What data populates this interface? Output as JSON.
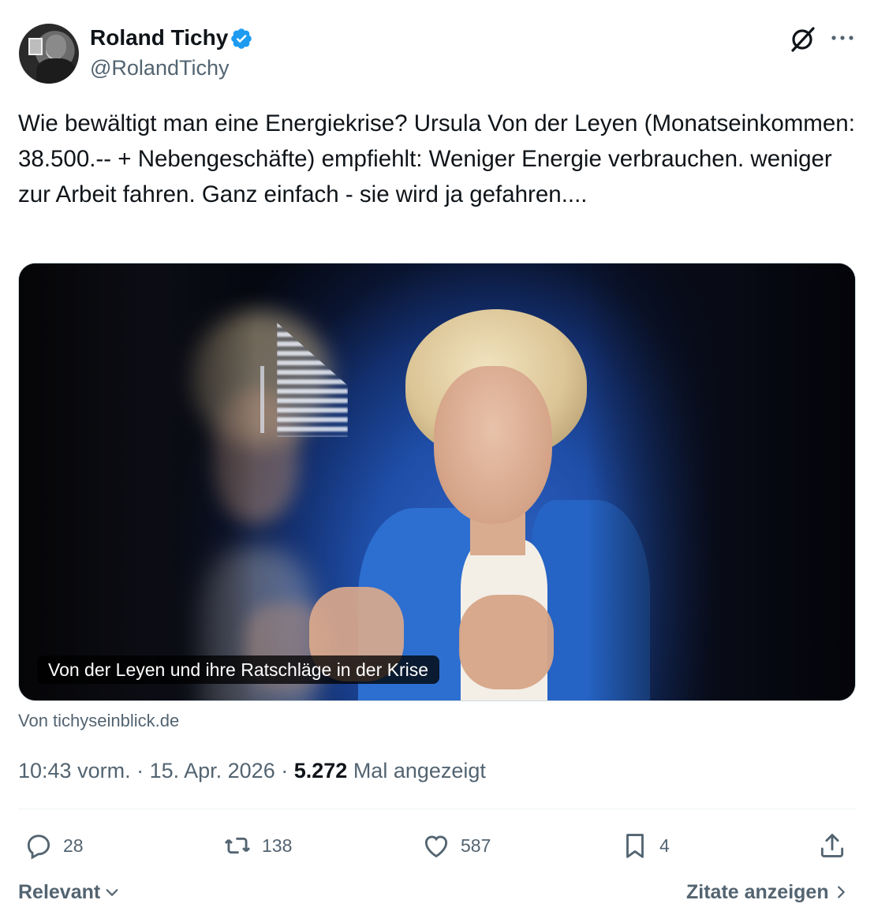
{
  "author": {
    "name": "Roland Tichy",
    "handle": "@RolandTichy",
    "verified": true,
    "verified_color": "#1d9bf0"
  },
  "header_icons": [
    "grok-icon",
    "more-icon"
  ],
  "tweet": {
    "text": "Wie bewältigt man eine Energiekrise? Ursula Von der Leyen (Monatseinkommen: 38.500.-- + Nebengeschäfte) empfiehlt: Weniger Energie verbrauchen. weniger zur Arbeit fahren. Ganz einfach - sie wird ja gefahren....",
    "media_caption": "Von der Leyen und ihre Ratschläge in der Krise",
    "source": "Von tichyseinblick.de"
  },
  "meta": {
    "time": "10:43 vorm.",
    "separator": " · ",
    "date": "15. Apr. 2026",
    "views_count": "5.272",
    "views_label": "Mal angezeigt"
  },
  "actions": {
    "reply_count": "28",
    "retweet_count": "138",
    "like_count": "587",
    "bookmark_count": "4"
  },
  "footer": {
    "sort_label": "Relevant",
    "quotes_label": "Zitate anzeigen"
  }
}
